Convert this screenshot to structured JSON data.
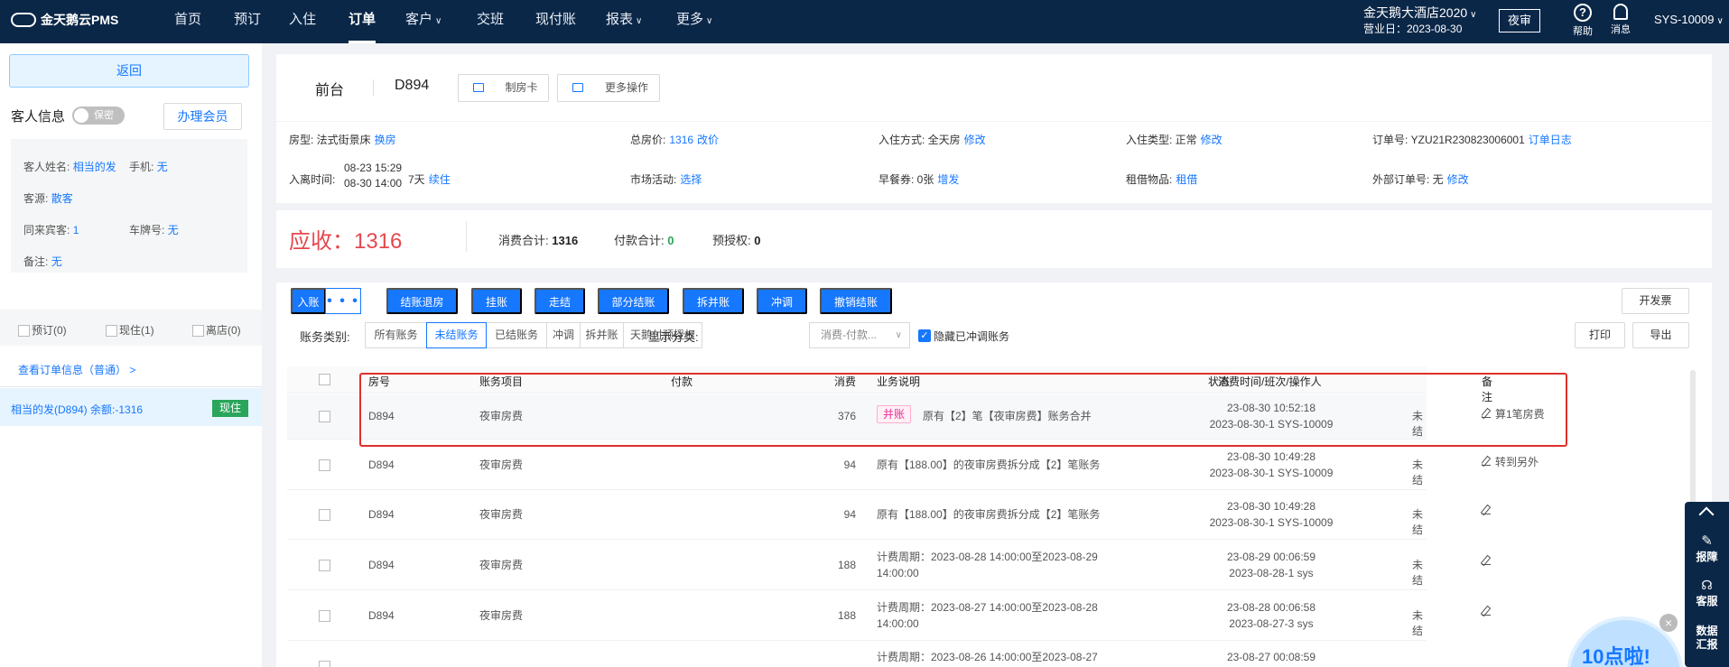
{
  "nav": {
    "logo": "金天鹅云PMS",
    "items": [
      "首页",
      "预订",
      "入住",
      "订单",
      "客户",
      "交班",
      "现付账",
      "报表",
      "更多"
    ],
    "hotel": "金天鹅大酒店2020",
    "biz_date": "营业日：2023-08-30",
    "audit": "夜审",
    "help": "帮助",
    "messages": "消息",
    "user": "SYS-10009"
  },
  "sidebar": {
    "back": "返回",
    "guest_title": "客人信息",
    "privacy": "保密",
    "member_button": "办理会员",
    "name_label": "客人姓名:",
    "name_value": "相当的发",
    "phone_label": "手机:",
    "phone_value": "无",
    "source_label": "客源:",
    "source_value": "散客",
    "companions_label": "同来宾客:",
    "companions_value": "1",
    "plate_label": "车牌号:",
    "plate_value": "无",
    "remark_label": "备注:",
    "remark_value": "无",
    "tabs": [
      "预订(0)",
      "现住(1)",
      "离店(0)"
    ],
    "order_info_link": "查看订单信息（普通） >",
    "room_entry": "相当的发(D894)  余额:-1316",
    "room_status": "现住"
  },
  "header": {
    "title": "前台",
    "room": "D894",
    "make_card": "制房卡",
    "more_ops": "更多操作"
  },
  "details": {
    "room_type_label": "房型: 法式街景床",
    "change_room": "换房",
    "total_label": "总房价:",
    "total_value": "1316",
    "change_price": "改价",
    "checkin_mode_label": "入住方式: 全天房",
    "checkin_mode_edit": "修改",
    "checkin_type_label": "入住类型: 正常",
    "checkin_type_edit": "修改",
    "order_no_label": "订单号: YZU21R230823006001",
    "order_log": "订单日志",
    "stay_label": "入离时间:",
    "stay_in": "08-23 15:29",
    "stay_out": "08-30 14:00",
    "stay_days": "7天",
    "extend": "续住",
    "market_label": "市场活动:",
    "market_select": "选择",
    "breakfast_label": "早餐券: 0张",
    "breakfast_add": "增发",
    "rental_label": "租借物品:",
    "rental_action": "租借",
    "ext_order_label": "外部订单号: 无",
    "ext_order_edit": "修改"
  },
  "summary": {
    "receivable": "应收：1316",
    "consume_label": "消费合计:",
    "consume_value": "1316",
    "payment_label": "付款合计:",
    "payment_value": "0",
    "preauth_label": "预授权:",
    "preauth_value": "0"
  },
  "actions": {
    "post": "入账",
    "more": "• • •",
    "buttons": [
      "结账退房",
      "挂账",
      "走结",
      "部分结账",
      "拆并账",
      "冲调",
      "撤销结账"
    ],
    "invoice": "开发票",
    "print": "打印",
    "export": "导出"
  },
  "filters": {
    "category_label": "账务类别:",
    "categories": [
      "所有账务",
      "未结账务",
      "已结账务",
      "冲调",
      "拆并账",
      "天鹅付预授权"
    ],
    "active_category": "未结账务",
    "display_label": "显示分类:",
    "display_value": "消费-付款...",
    "hide_reversed": "隐藏已冲调账务"
  },
  "table": {
    "columns": [
      "房号",
      "账务项目",
      "付款",
      "消费",
      "业务说明",
      "消费时间/班次/操作人",
      "状态",
      "备注"
    ],
    "rows": [
      {
        "room": "D894",
        "item": "夜审房费",
        "payment": "",
        "consume": "376",
        "tag": "并账",
        "desc": "原有【2】笔【夜审房费】账务合并",
        "desc2": "",
        "time": "23-08-30 10:52:18",
        "shift": "2023-08-30-1 SYS-10009",
        "status": "未结",
        "remark": "算1笔房费"
      },
      {
        "room": "D894",
        "item": "夜审房费",
        "payment": "",
        "consume": "94",
        "tag": "",
        "desc": "原有【188.00】的夜审房费拆分成【2】笔账务",
        "desc2": "",
        "time": "23-08-30 10:49:28",
        "shift": "2023-08-30-1 SYS-10009",
        "status": "未结",
        "remark": "转到另外"
      },
      {
        "room": "D894",
        "item": "夜审房费",
        "payment": "",
        "consume": "94",
        "tag": "",
        "desc": "原有【188.00】的夜审房费拆分成【2】笔账务",
        "desc2": "",
        "time": "23-08-30 10:49:28",
        "shift": "2023-08-30-1 SYS-10009",
        "status": "未结",
        "remark": ""
      },
      {
        "room": "D894",
        "item": "夜审房费",
        "payment": "",
        "consume": "188",
        "tag": "",
        "desc": "计费周期：2023-08-28 14:00:00至2023-08-29",
        "desc2": "14:00:00",
        "time": "23-08-29 00:06:59",
        "shift": "2023-08-28-1 sys",
        "status": "未结",
        "remark": ""
      },
      {
        "room": "D894",
        "item": "夜审房费",
        "payment": "",
        "consume": "188",
        "tag": "",
        "desc": "计费周期：2023-08-27 14:00:00至2023-08-28",
        "desc2": "14:00:00",
        "time": "23-08-28 00:06:58",
        "shift": "2023-08-27-3 sys",
        "status": "未结",
        "remark": ""
      },
      {
        "room": "",
        "item": "",
        "payment": "",
        "consume": "",
        "tag": "",
        "desc": "计费周期：2023-08-26 14:00:00至2023-08-27",
        "desc2": "",
        "time": "23-08-27 00:08:59",
        "shift": "",
        "status": "",
        "remark": ""
      }
    ]
  },
  "floatbar": {
    "repair": "报障",
    "service": "客服",
    "report1": "数据",
    "report2": "汇报"
  },
  "promo": "10点啦!",
  "colors": {
    "nav_bg": "#0b2748",
    "primary": "#1677ff",
    "receivable": "#e5484d",
    "highlight": "#e0302c",
    "status_green": "#2aa55c"
  }
}
